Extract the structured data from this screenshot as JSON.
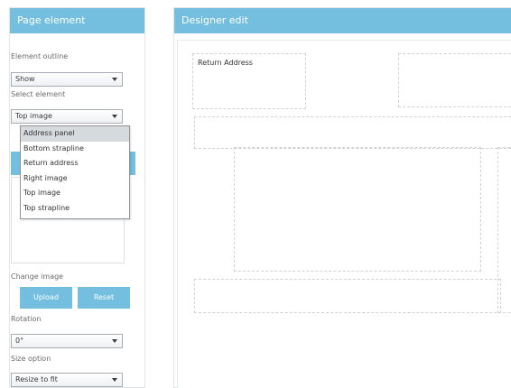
{
  "left_panel": {
    "title": "Page element",
    "element_outline": {
      "label": "Element outline",
      "value": "Show"
    },
    "select_element": {
      "label": "Select element",
      "value": "Top image",
      "options": [
        "Address panel",
        "Bottom strapline",
        "Return address",
        "Right image",
        "Top image",
        "Top strapline"
      ],
      "highlighted": "Address panel"
    },
    "change_image": {
      "label": "Change image",
      "upload_label": "Upload",
      "reset_label": "Reset"
    },
    "rotation": {
      "label": "Rotation",
      "value": "0°"
    },
    "size_option": {
      "label": "Size option",
      "value": "Resize to fit"
    }
  },
  "designer": {
    "title": "Designer edit",
    "return_address_label": "Return Address"
  },
  "colors": {
    "accent": "#74bfe0"
  }
}
